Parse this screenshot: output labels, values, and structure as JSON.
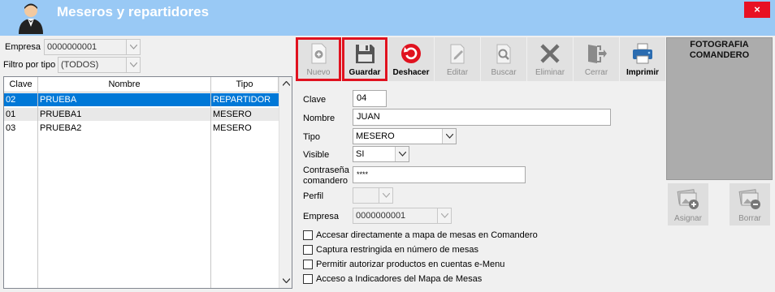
{
  "window": {
    "title": "Meseros y repartidores",
    "close_label": "×"
  },
  "filters": {
    "empresa_label": "Empresa",
    "empresa_value": "0000000001",
    "filtro_label": "Filtro por tipo",
    "filtro_value": "(TODOS)"
  },
  "grid": {
    "columns": [
      "Clave",
      "Nombre",
      "Tipo"
    ],
    "rows": [
      {
        "clave": "02",
        "nombre": "PRUEBA",
        "tipo": "REPARTIDOR",
        "selected": true
      },
      {
        "clave": "01",
        "nombre": "PRUEBA1",
        "tipo": "MESERO",
        "selected": false
      },
      {
        "clave": "03",
        "nombre": "PRUEBA2",
        "tipo": "MESERO",
        "selected": false
      }
    ]
  },
  "toolbar": {
    "nuevo": "Nuevo",
    "guardar": "Guardar",
    "deshacer": "Deshacer",
    "editar": "Editar",
    "buscar": "Buscar",
    "eliminar": "Eliminar",
    "cerrar": "Cerrar",
    "imprimir": "Imprimir"
  },
  "form": {
    "clave_label": "Clave",
    "clave_value": "04",
    "nombre_label": "Nombre",
    "nombre_value": "JUAN",
    "tipo_label": "Tipo",
    "tipo_value": "MESERO",
    "visible_label": "Visible",
    "visible_value": "SI",
    "contrasena_label_1": "Contraseña",
    "contrasena_label_2": "comandero",
    "contrasena_value": "****",
    "perfil_label": "Perfil",
    "perfil_value": "",
    "empresa_label": "Empresa",
    "empresa_value": "0000000001"
  },
  "options": [
    {
      "label": "Accesar directamente a mapa de mesas en Comandero",
      "checked": false
    },
    {
      "label": "Captura restringida en número de mesas",
      "checked": false
    },
    {
      "label": "Permitir autorizar productos en cuentas e-Menu",
      "checked": false
    },
    {
      "label": "Acceso a Indicadores del Mapa de Mesas",
      "checked": false
    }
  ],
  "photo": {
    "title_1": "FOTOGRAFIA",
    "title_2": "COMANDERO",
    "asignar": "Asignar",
    "borrar": "Borrar"
  },
  "colors": {
    "titlebar": "#99c9f5",
    "selected_row": "#0078d7",
    "highlight_border": "#e0121f",
    "close_button": "#e81123",
    "undo_red": "#e0121f"
  },
  "icons": {
    "window": "waiter-avatar-icon",
    "nuevo": "new-document-icon",
    "guardar": "floppy-disk-icon",
    "deshacer": "undo-icon",
    "editar": "pencil-document-icon",
    "buscar": "magnifier-document-icon",
    "eliminar": "x-icon",
    "cerrar": "exit-door-icon",
    "imprimir": "printer-icon",
    "asignar": "photo-add-icon",
    "borrar": "photo-remove-icon"
  }
}
